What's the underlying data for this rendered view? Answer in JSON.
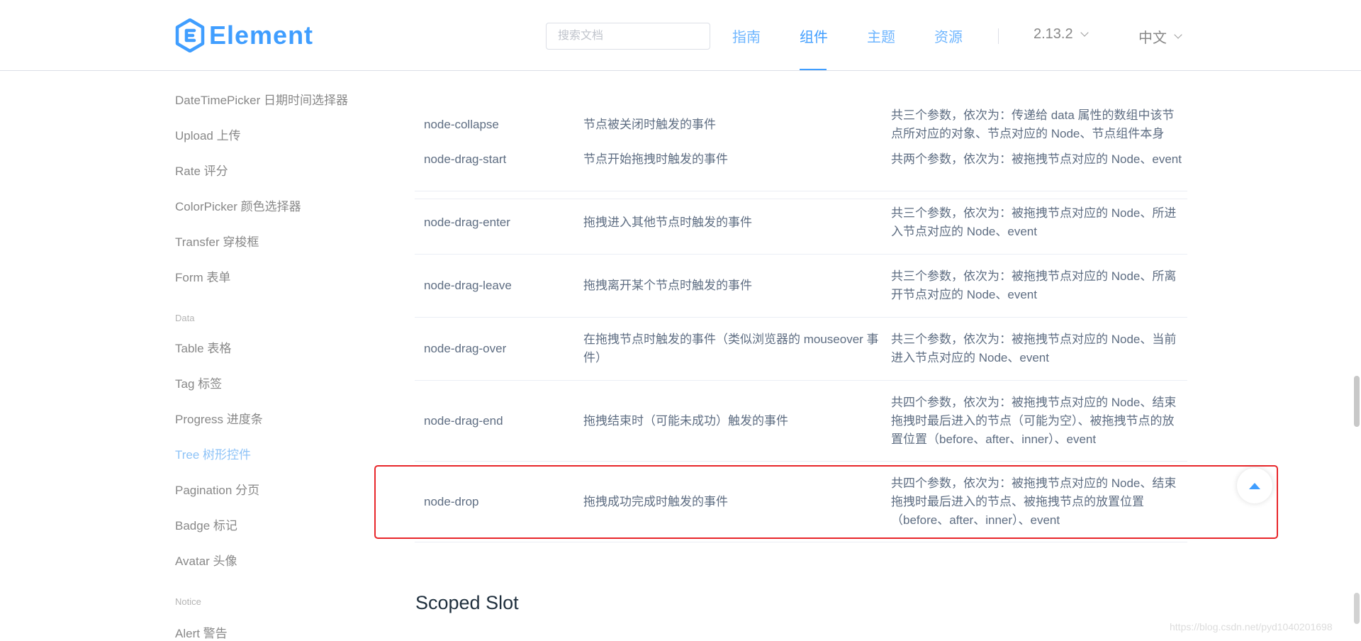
{
  "header": {
    "logo_text": "Element",
    "search_placeholder": "搜索文档",
    "nav": [
      "指南",
      "组件",
      "主题",
      "资源"
    ],
    "version": "2.13.2",
    "language": "中文"
  },
  "sidebar": {
    "items": [
      "DateTimePicker 日期时间选择器",
      "Upload 上传",
      "Rate 评分",
      "ColorPicker 颜色选择器",
      "Transfer 穿梭框",
      "Form 表单",
      "Table 表格",
      "Tag 标签",
      "Progress 进度条",
      "Tree 树形控件",
      "Pagination 分页",
      "Badge 标记",
      "Avatar 头像",
      "Alert 警告"
    ],
    "groups": [
      "Data",
      "Notice"
    ],
    "active_item": "Tree 树形控件"
  },
  "events_table": {
    "rows": [
      {
        "name": "node-collapse",
        "desc": "节点被关闭时触发的事件",
        "params": "共三个参数，依次为：传递给 data 属性的数组中该节点所对应的对象、节点对应的 Node、节点组件本身"
      },
      {
        "name": "node-drag-start",
        "desc": "节点开始拖拽时触发的事件",
        "params": "共两个参数，依次为：被拖拽节点对应的 Node、event"
      },
      {
        "name": "node-drag-enter",
        "desc": "拖拽进入其他节点时触发的事件",
        "params": "共三个参数，依次为：被拖拽节点对应的 Node、所进入节点对应的 Node、event"
      },
      {
        "name": "node-drag-leave",
        "desc": "拖拽离开某个节点时触发的事件",
        "params": "共三个参数，依次为：被拖拽节点对应的 Node、所离开节点对应的 Node、event"
      },
      {
        "name": "node-drag-over",
        "desc": "在拖拽节点时触发的事件（类似浏览器的 mouseover 事件）",
        "params": "共三个参数，依次为：被拖拽节点对应的 Node、当前进入节点对应的 Node、event"
      },
      {
        "name": "node-drag-end",
        "desc": "拖拽结束时（可能未成功）触发的事件",
        "params": "共四个参数，依次为：被拖拽节点对应的 Node、结束拖拽时最后进入的节点（可能为空）、被拖拽节点的放置位置（before、after、inner）、event"
      },
      {
        "name": "node-drop",
        "desc": "拖拽成功完成时触发的事件",
        "params": "共四个参数，依次为：被拖拽节点对应的 Node、结束拖拽时最后进入的节点、被拖拽节点的放置位置（before、after、inner）、event"
      }
    ]
  },
  "section_title": "Scoped Slot",
  "watermark": "https://blog.csdn.net/pyd1040201698",
  "colors": {
    "brand": "#409eff",
    "highlight_border": "#e8262a"
  }
}
